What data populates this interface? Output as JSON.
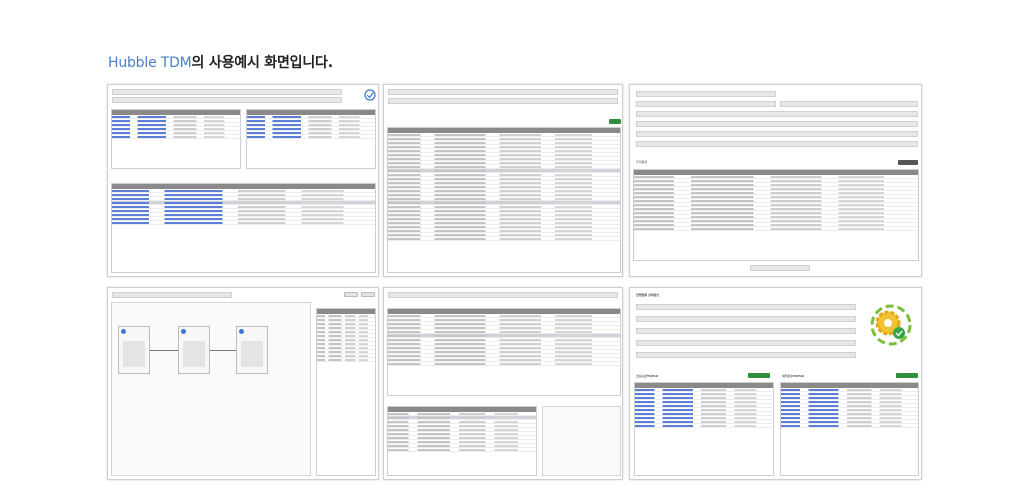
{
  "headline": {
    "brand": "Hubble TDM",
    "rest": "의 사용예시 화면입니다."
  },
  "screens": [
    {
      "name": "screen-1"
    },
    {
      "name": "screen-2"
    },
    {
      "name": "screen-3"
    },
    {
      "name": "screen-4"
    },
    {
      "name": "screen-5"
    },
    {
      "name": "screen-6"
    }
  ],
  "screen3": {
    "panel_title": "추적종류",
    "button_label": "다운로드"
  },
  "screen6": {
    "title": "진행현황 상세정보",
    "left_section": "소요시간TOP10",
    "right_section": "처리건수TOP10",
    "download": "다운로드"
  },
  "colors": {
    "brand": "#4a7fc1",
    "header_gray": "#8a8a8a",
    "action_green": "#2f8f3a",
    "link_blue": "#3b5fd0"
  }
}
